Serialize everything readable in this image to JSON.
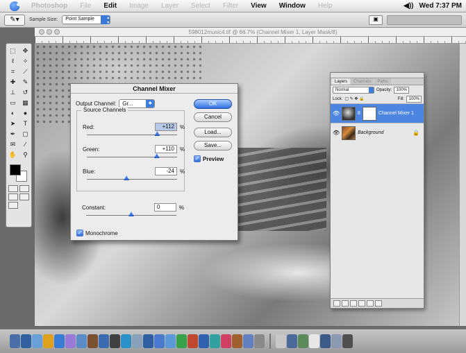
{
  "menubar": {
    "app_name": "Photoshop",
    "items": [
      "File",
      "Edit",
      "Image",
      "Layer",
      "Select",
      "Filter",
      "View",
      "Window",
      "Help"
    ],
    "clock": "Wed 7:37 PM"
  },
  "options": {
    "sample_size_label": "Sample Size:",
    "sample_size_value": "Point Sample"
  },
  "document": {
    "title": "598012music4.tif @ 66.7% (Channel Mixer 1, Layer Mask/8)"
  },
  "channel_mixer": {
    "title": "Channel Mixer",
    "output_channel_label": "Output Channel:",
    "output_channel_value": "Gr...",
    "source_channels_label": "Source Channels",
    "red_label": "Red:",
    "red_value": "+112",
    "green_label": "Green:",
    "green_value": "+110",
    "blue_label": "Blue:",
    "blue_value": "-24",
    "constant_label": "Constant:",
    "constant_value": "0",
    "percent": "%",
    "red_fraction": 0.78,
    "green_fraction": 0.775,
    "blue_fraction": 0.44,
    "constant_fraction": 0.5,
    "monochrome_label": "Monochrome",
    "monochrome_checked": true,
    "preview_label": "Preview",
    "preview_checked": true,
    "ok_label": "OK",
    "cancel_label": "Cancel",
    "load_label": "Load...",
    "save_label": "Save..."
  },
  "layers_palette": {
    "tabs": [
      "Layers",
      "Channels",
      "Paths"
    ],
    "blend_mode": "Normal",
    "opacity_label": "Opacity:",
    "opacity_value": "100%",
    "fill_label": "Fill:",
    "fill_value": "100%",
    "lock_label": "Lock:",
    "layers": [
      {
        "name": "Channel Mixer 1",
        "selected": true
      },
      {
        "name": "Background",
        "selected": false
      }
    ]
  }
}
